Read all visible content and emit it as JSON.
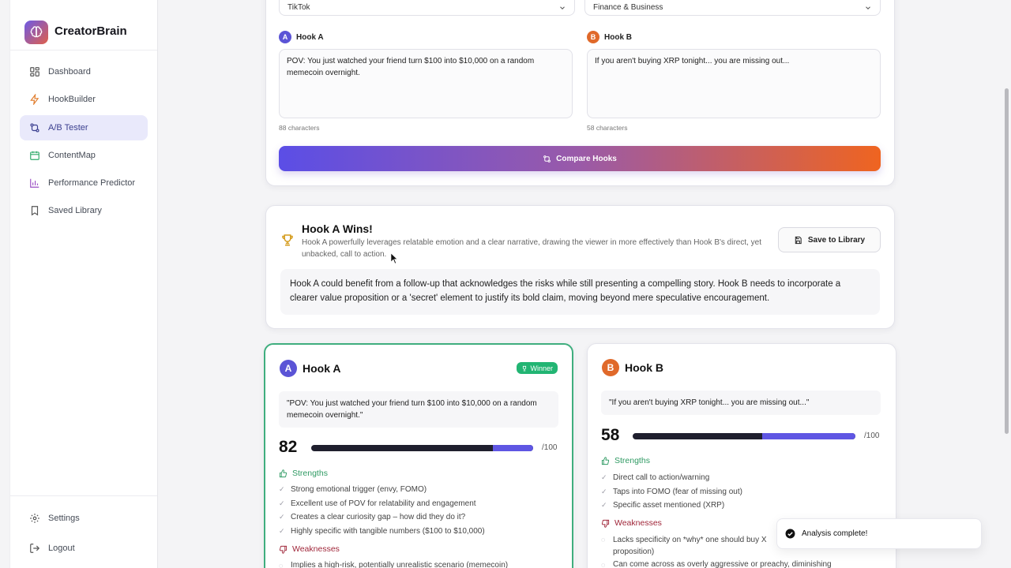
{
  "app": {
    "name": "CreatorBrain"
  },
  "sidebar": {
    "items": [
      {
        "label": "Dashboard",
        "icon": "grid-icon"
      },
      {
        "label": "HookBuilder",
        "icon": "lightning-icon"
      },
      {
        "label": "A/B Tester",
        "icon": "split-icon",
        "active": true
      },
      {
        "label": "ContentMap",
        "icon": "calendar-icon"
      },
      {
        "label": "Performance Predictor",
        "icon": "bar-chart-icon"
      },
      {
        "label": "Saved Library",
        "icon": "bookmark-icon"
      }
    ],
    "bottom": [
      {
        "label": "Settings",
        "icon": "gear-icon"
      },
      {
        "label": "Logout",
        "icon": "logout-icon"
      }
    ]
  },
  "form": {
    "platform": "TikTok",
    "niche": "Finance & Business",
    "hook_a": {
      "label": "Hook A",
      "badge": "A",
      "text": "POV: You just watched your friend turn $100 into $10,000 on a random memecoin overnight.",
      "count": "88 characters"
    },
    "hook_b": {
      "label": "Hook B",
      "badge": "B",
      "text": "If you aren't buying XRP tonight... you are missing out...",
      "count": "58 characters"
    },
    "compare_label": "Compare Hooks"
  },
  "verdict": {
    "title": "Hook A Wins!",
    "description": "Hook A powerfully leverages relatable emotion and a clear narrative, drawing the viewer in more effectively than Hook B's direct, yet unbacked, call to action.",
    "save_label": "Save to Library",
    "suggestion": "Hook A could benefit from a follow-up that acknowledges the risks while still presenting a compelling story. Hook B needs to incorporate a clearer value proposition or a 'secret' element to justify its bold claim, moving beyond mere speculative encouragement."
  },
  "results": {
    "a": {
      "title": "Hook A",
      "badge": "A",
      "winner_label": "Winner",
      "quote": "\"POV: You just watched your friend turn $100 into $10,000 on a random memecoin overnight.\"",
      "score": "82",
      "score_value": 82,
      "of": "/100",
      "strengths_title": "Strengths",
      "strengths": [
        "Strong emotional trigger (envy, FOMO)",
        "Excellent use of POV for relatability and engagement",
        "Creates a clear curiosity gap – how did they do it?",
        "Highly specific with tangible numbers ($100 to $10,000)"
      ],
      "weaknesses_title": "Weaknesses",
      "weaknesses": [
        "Implies a high-risk, potentially unrealistic scenario (memecoin)"
      ]
    },
    "b": {
      "title": "Hook B",
      "badge": "B",
      "quote": "\"If you aren't buying XRP tonight... you are missing out...\"",
      "score": "58",
      "score_value": 58,
      "of": "/100",
      "strengths_title": "Strengths",
      "strengths": [
        "Direct call to action/warning",
        "Taps into FOMO (fear of missing out)",
        "Specific asset mentioned (XRP)"
      ],
      "weaknesses_title": "Weaknesses",
      "weaknesses": [
        "Lacks specificity on *why* one should buy X",
        "proposition)",
        "Can come across as overly aggressive or preachy, diminishing"
      ]
    }
  },
  "toast": {
    "message": "Analysis complete!"
  },
  "colors": {
    "accent": "#5b54d6",
    "orange": "#e0692a",
    "success": "#22b573",
    "danger": "#a0273a"
  }
}
